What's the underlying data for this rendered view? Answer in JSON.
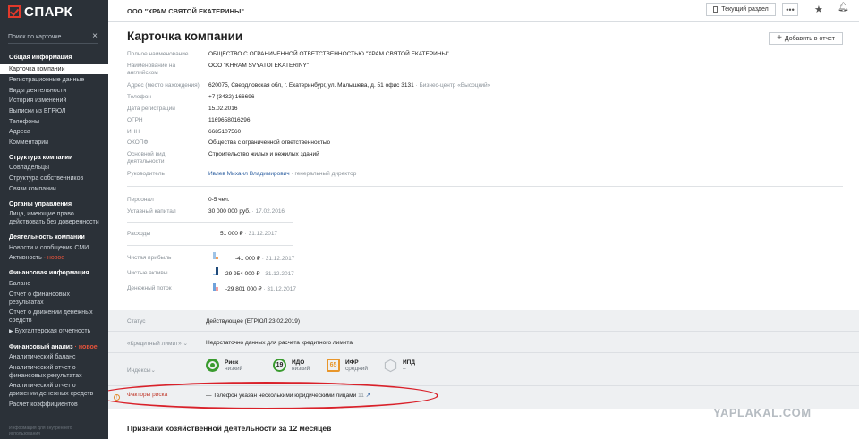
{
  "app": {
    "logo": "СПАРК"
  },
  "sidebar": {
    "search_placeholder": "Поиск по карточке",
    "sections": [
      {
        "title": "Общая информация",
        "items": [
          "Карточка компании",
          "Регистрационные данные",
          "Виды деятельности",
          "История изменений",
          "Выписки из ЕГРЮЛ",
          "Телефоны",
          "Адреса",
          "Комментарии"
        ]
      },
      {
        "title": "Структура компании",
        "items": [
          "Совладельцы",
          "Структура собственников",
          "Связи компании"
        ]
      },
      {
        "title": "Органы управления",
        "items": [
          "Лица, имеющие право действовать без доверенности"
        ]
      },
      {
        "title": "Деятельность компании",
        "items": [
          "Новости и сообщения СМИ",
          "Активность"
        ]
      },
      {
        "title": "Финансовая информация",
        "items": [
          "Баланс",
          "Отчет о финансовых результатах",
          "Отчет о движении денежных средств",
          "Бухгалтерская отчетность"
        ]
      },
      {
        "title": "Финансовый анализ",
        "items": [
          "Аналитический баланс",
          "Аналитический отчет о финансовых результатах",
          "Аналитический отчет о движении денежных средств",
          "Расчет коэффициентов"
        ]
      }
    ],
    "new_label": "новое",
    "footer": "Информация для внутреннего использования"
  },
  "topbar": {
    "company": "ООО \"ХРАМ СВЯТОЙ ЕКАТЕРИНЫ\"",
    "section_button": "Текущий раздел",
    "more": "•••"
  },
  "main": {
    "title": "Карточка компании",
    "add_to_report": "Добавить в отчет",
    "fields": [
      {
        "label": "Полное наименование",
        "value": "ОБЩЕСТВО С ОГРАНИЧЕННОЙ ОТВЕТСТВЕННОСТЬЮ \"ХРАМ СВЯТОЙ ЕКАТЕРИНЫ\""
      },
      {
        "label": "Наименование на английском",
        "value": "OOO \"KHRAM SVYATOI EKATERINY\""
      },
      {
        "label": "Адрес (место нахождения)",
        "value": "620075, Свердловская обл, г. Екатеринбург, ул. Малышева, д. 51 офис 3131",
        "extra": " · Бизнес-центр «Высоцкий»"
      },
      {
        "label": "Телефон",
        "value": "+7 (3432) 166696"
      },
      {
        "label": "Дата регистрации",
        "value": "15.02.2016"
      },
      {
        "label": "ОГРН",
        "value": "1169658016296"
      },
      {
        "label": "ИНН",
        "value": "6685107560"
      },
      {
        "label": "ОКОПФ",
        "value": "Общества с ограниченной ответственностью"
      },
      {
        "label": "Основной вид деятельности",
        "value": "Строительство жилых и нежилых зданий"
      },
      {
        "label": "Руководитель",
        "value": "Ивлев Михаил Владимирович",
        "extra": " · генеральный директор"
      }
    ],
    "staff_label": "Персонал",
    "staff_value": "0-5 чел.",
    "capital_label": "Уставный капитал",
    "capital_value": "30 000 000 руб.",
    "capital_date": " · 17.02.2016",
    "expenses_label": "Расходы",
    "expenses_value": "51 000 ₽",
    "expenses_date": " · 31.12.2017",
    "profit_label": "Чистая прибыль",
    "profit_value": "-41 000 ₽",
    "profit_date": " · 31.12.2017",
    "assets_label": "Чистые активы",
    "assets_value": "29 954 000 ₽",
    "assets_date": " · 31.12.2017",
    "cashflow_label": "Денежный поток",
    "cashflow_value": "-29 801 000 ₽",
    "cashflow_date": " · 31.12.2017"
  },
  "status": {
    "label": "Статус",
    "value": "Действующее (ЕГРЮЛ 23.02.2019)",
    "credit_label": "«Кредитный лимит»",
    "credit_value": "Недостаточно данных для расчета кредитного лимита",
    "indexes_label": "Индексы",
    "indexes": [
      {
        "name": "Риск",
        "level": "низкий",
        "value": "",
        "color": "#3a9b2f"
      },
      {
        "name": "ИДО",
        "level": "низкий",
        "value": "19",
        "color": "#3a9b2f"
      },
      {
        "name": "ИФР",
        "level": "средний",
        "value": "65",
        "color": "#e8962b"
      },
      {
        "name": "ИПД",
        "level": "–",
        "value": "",
        "color": "#b9bec3"
      }
    ],
    "risk_label": "Факторы риска",
    "risk_value": "— Телефон указан несколькими юридическими лицами",
    "risk_count": "11"
  },
  "section_heading": "Признаки хозяйственной деятельности за 12 месяцев",
  "watermark": "YAPLAKAL.COM"
}
